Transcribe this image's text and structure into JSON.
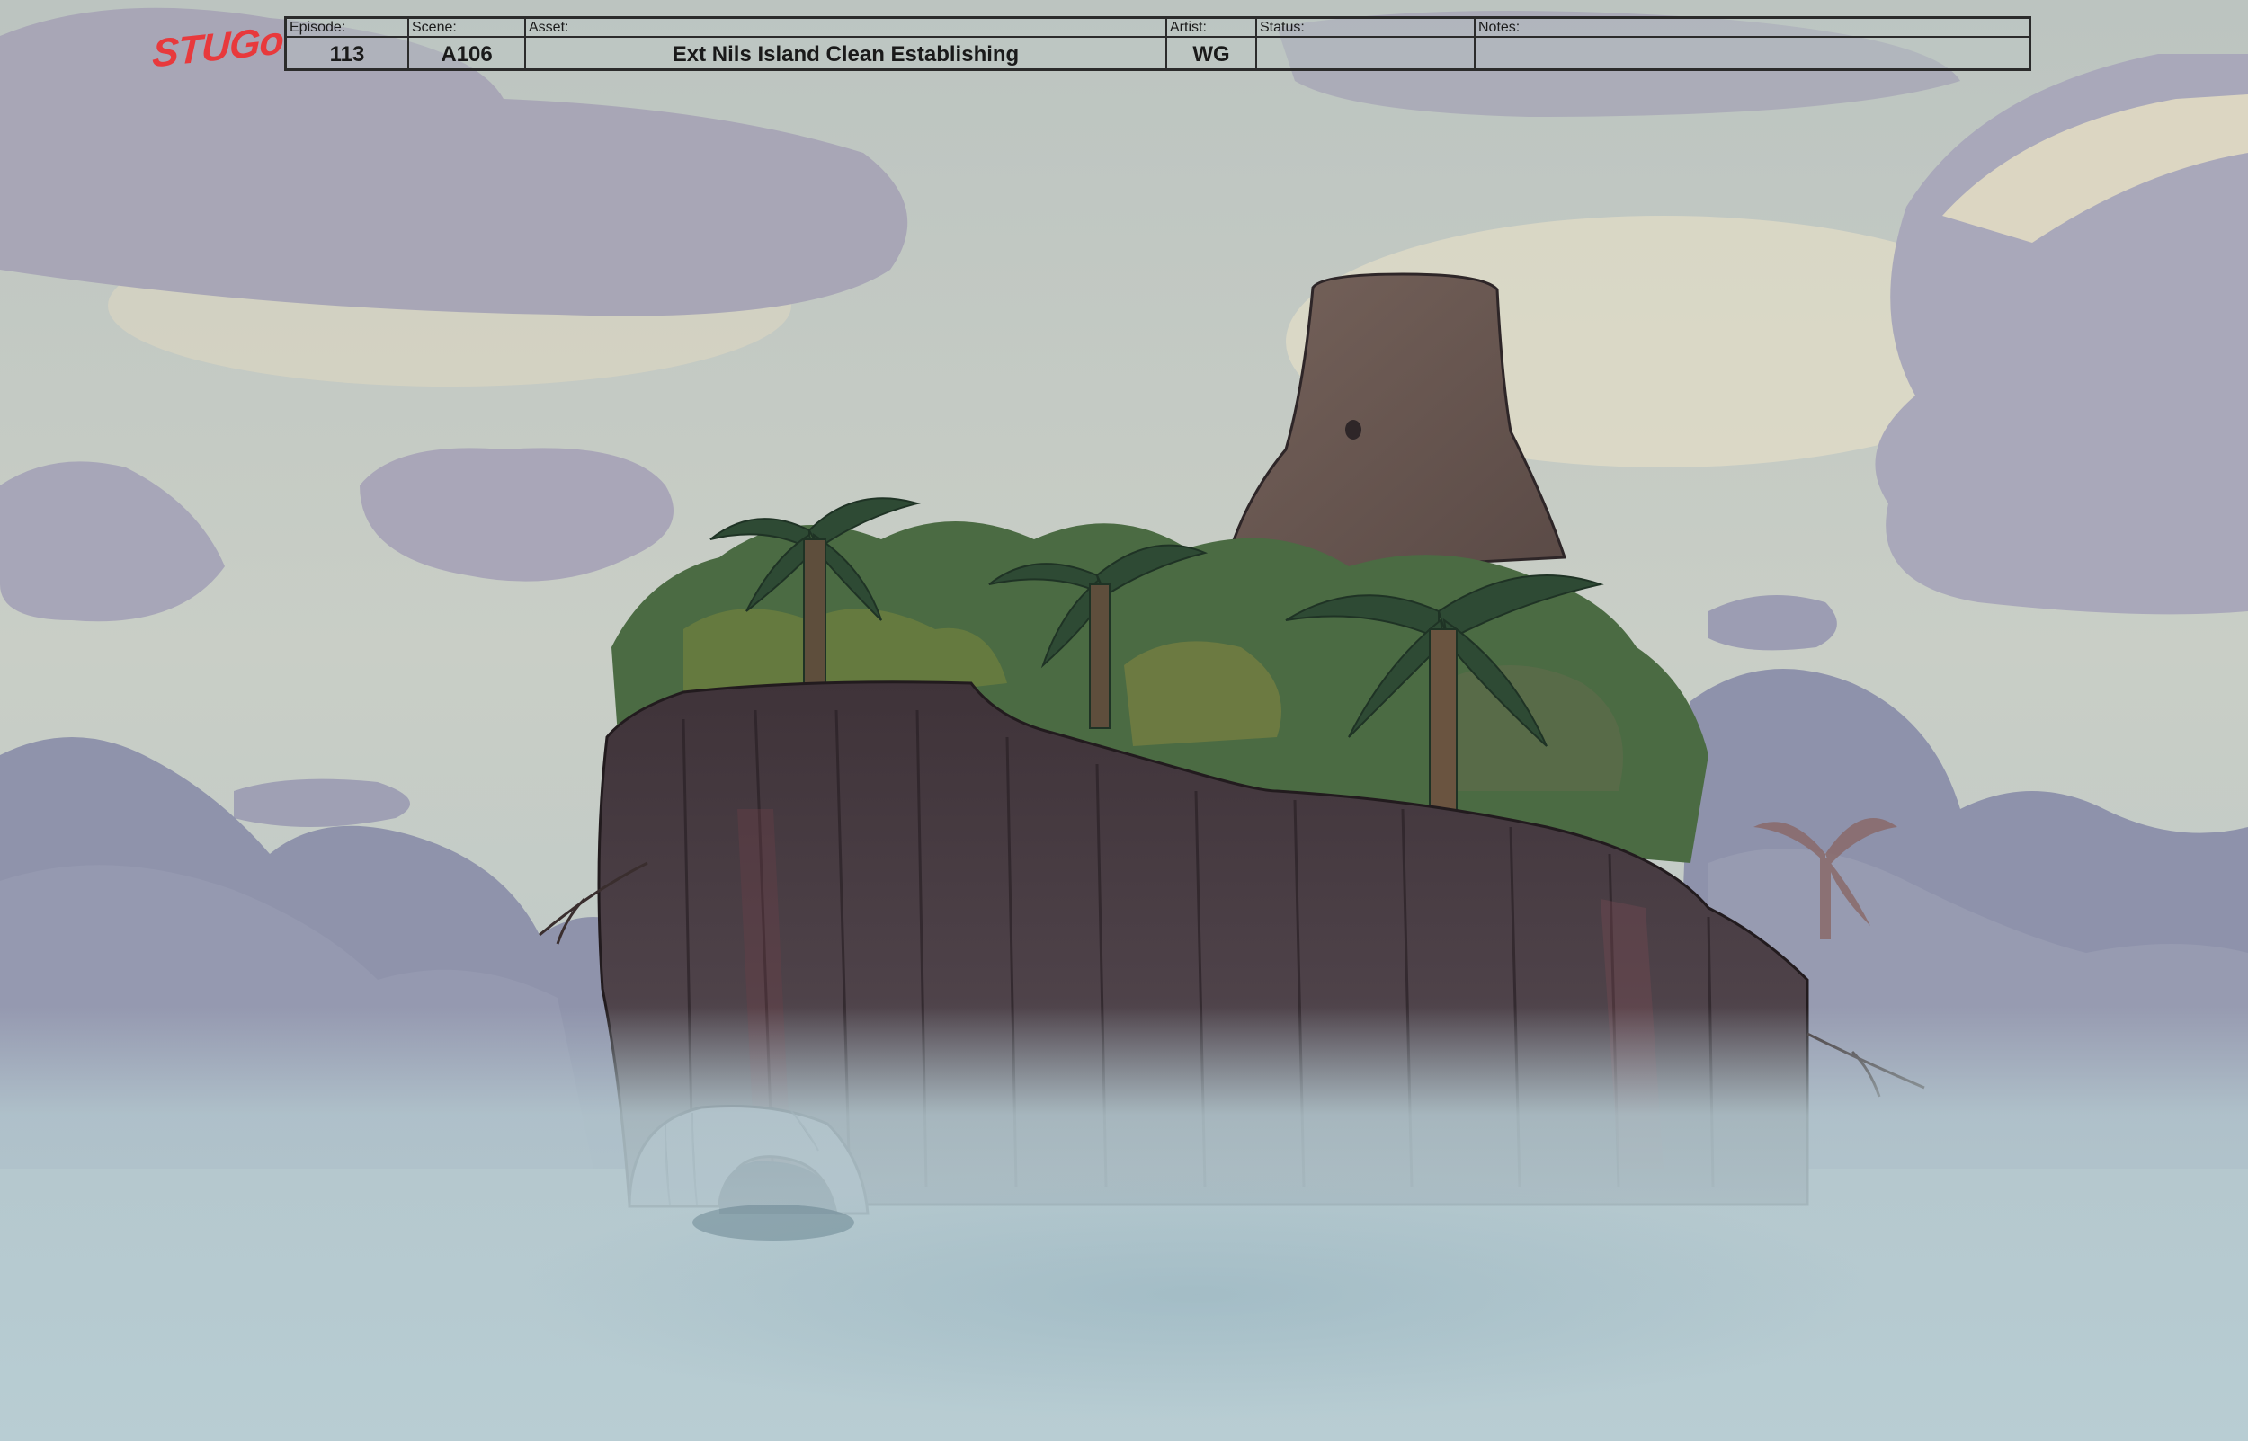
{
  "logo": {
    "text": "STUGo",
    "color": "#e8393c"
  },
  "slate": {
    "fields": [
      {
        "label": "Episode:",
        "value": "113"
      },
      {
        "label": "Scene:",
        "value": "A106"
      },
      {
        "label": "Asset:",
        "value": "Ext Nils Island Clean Establishing"
      },
      {
        "label": "Artist:",
        "value": "WG"
      },
      {
        "label": "Status:",
        "value": ""
      },
      {
        "label": "Notes:",
        "value": ""
      }
    ]
  },
  "colors": {
    "sky": "#c3cbc6",
    "cloud": "#a9a8b8",
    "mist": "#b8cdd2",
    "cliff": "#4b3f45",
    "foliage": "#3e5a3c"
  }
}
